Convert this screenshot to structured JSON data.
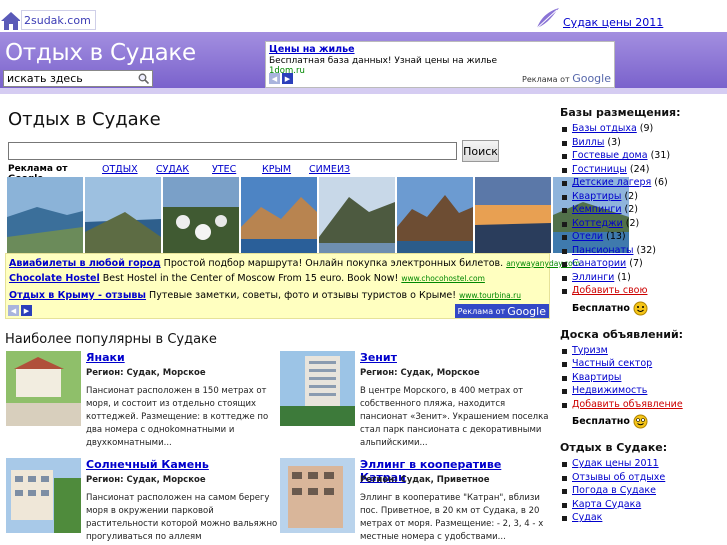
{
  "topbar": {
    "logo_text": "2sudak.com",
    "right_link": "Судак цены 2011"
  },
  "header": {
    "title": "Отдых в Судаке",
    "search_placeholder": "искать здесь",
    "ad": {
      "title": "Цены на жилье",
      "text": "Бесплатная база данных! Узнай цены на жилье",
      "url": "1dom.ru",
      "ads_by": "Реклама от",
      "google": "Google"
    }
  },
  "main": {
    "title": "Отдых в Судаке",
    "search_button": "Поиск",
    "ads_label": "Реклама от Google",
    "links": [
      "ОТДЫХ",
      "СУДАК",
      "УТЕС",
      "КРЫМ",
      "СИМЕИЗ"
    ],
    "bigad": {
      "lines": [
        {
          "title": "Авиабилеты в любой город",
          "text": " Простой подбор маршрута! Онлайн покупка электронных билетов. ",
          "url": "anywayanyday.com"
        },
        {
          "title": "Chocolate Hostel",
          "text": " Best Hostel in the Center of Moscow From 15 euro. Book Now! ",
          "url": "www.chocohostel.com"
        },
        {
          "title": "Отдых в Крыму - отзывы",
          "text": " Путевые заметки, советы, фото и отзывы туристов о Крыме! ",
          "url": "www.tourbina.ru"
        }
      ],
      "ads_by": "Реклама от",
      "google": "Google"
    },
    "popular_title": "Наиболее популярны в Судаке",
    "cards": [
      {
        "name": "Янаки",
        "region": "Регион: Судак, Морское",
        "desc": "Пансионат расположен в 150 метрах от моря, и состоит из отдельно стоящих коттеджей. Размещение: в коттедже по два номера с одноkомнатными и двухкомнатными..."
      },
      {
        "name": "Зенит",
        "region": "Регион: Судак, Морское",
        "desc": "В центре Морского, в 400 метрах от собственного пляжа, находится пансионат «Зенит». Украшением поселка стал парк пансионата с декоративными альпийскими..."
      },
      {
        "name": "Солнечный Камень",
        "region": "Регион: Судак, Морское",
        "desc": "Пансионат расположен на самом берегу моря в окружении парковой растительности которой можно вальяжно прогуливаться по аллеям"
      },
      {
        "name": "Эллинг в кооперативе Катран",
        "region": "Регион: Судак, Приветное",
        "desc": "Эллинг в кооперативе \"Катран\", вблизи пос. Привет­ное, в 20 км от Судака, в 20 метрах от моря. Размещение: - 2, 3, 4 - х местные номера с удобствами..."
      }
    ]
  },
  "sidebar": {
    "sec1_title": "Базы размещения:",
    "sec1_items": [
      {
        "label": "Базы отдыха",
        "count": " (9)"
      },
      {
        "label": "Виллы",
        "count": " (3)"
      },
      {
        "label": "Гостевые дома",
        "count": " (31)"
      },
      {
        "label": "Гостиницы",
        "count": " (24)"
      },
      {
        "label": "Детские лагеря",
        "count": " (6)"
      },
      {
        "label": "Квартиры",
        "count": " (2)"
      },
      {
        "label": "Кемпинги",
        "count": " (2)"
      },
      {
        "label": "Коттеджи",
        "count": " (2)"
      },
      {
        "label": "Отели",
        "count": " (13)"
      },
      {
        "label": "Пансионаты",
        "count": " (32)"
      },
      {
        "label": "Санатории",
        "count": " (7)"
      },
      {
        "label": "Эллинги",
        "count": " (1)"
      }
    ],
    "sec1_add": "Добавить свою",
    "free": "Бесплатно",
    "sec2_title": "Доска объявлений:",
    "sec2_items": [
      "Туризм",
      "Частный сектор",
      "Квартиры",
      "Недвижимость"
    ],
    "sec2_add": "Добавить объявление",
    "sec3_title": "Отдых в Судаке:",
    "sec3_items": [
      "Судак цены 2011",
      "Отзывы об отдыхе",
      "Погода в Судаке",
      "Карта Судака",
      "Судак"
    ]
  },
  "colors": {
    "header_purple": "#8a73d6",
    "link": "#0000cc",
    "ad_yellow": "#ffffc0"
  }
}
